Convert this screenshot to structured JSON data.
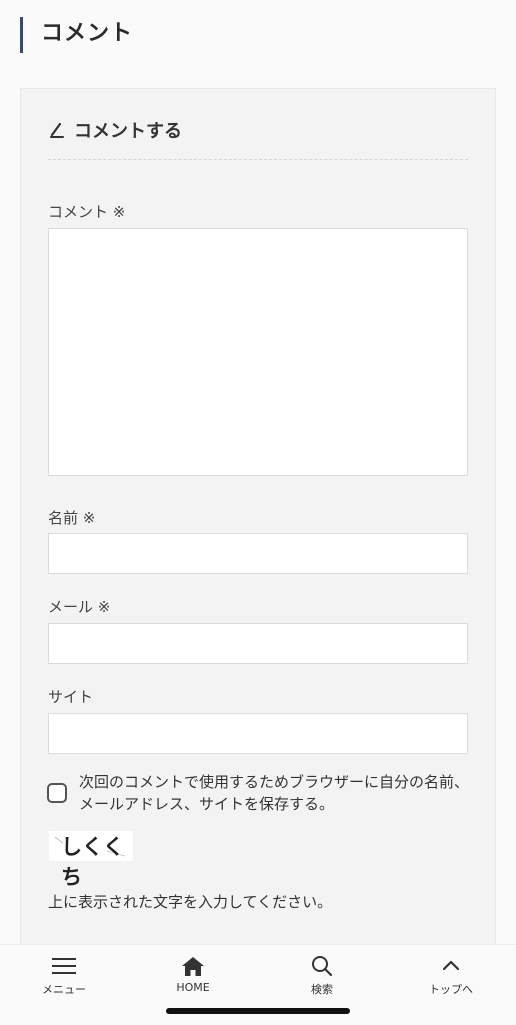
{
  "section": {
    "heading": "コメント"
  },
  "form": {
    "title": "コメントする",
    "comment_label": "コメント ※",
    "name_label": "名前 ※",
    "email_label": "メール ※",
    "site_label": "サイト",
    "save_consent": "次回のコメントで使用するためブラウザーに自分の名前、メールアドレス、サイトを保存する。",
    "save_consent_checked": false,
    "captcha_text": "しくくち",
    "captcha_instructions": "上に表示された文字を入力してください。"
  },
  "bottom_nav": {
    "items": [
      {
        "label": "メニュー",
        "icon": "menu-icon"
      },
      {
        "label": "HOME",
        "icon": "home-icon"
      },
      {
        "label": "検索",
        "icon": "search-icon"
      },
      {
        "label": "トップへ",
        "icon": "chevron-up-icon"
      }
    ]
  }
}
